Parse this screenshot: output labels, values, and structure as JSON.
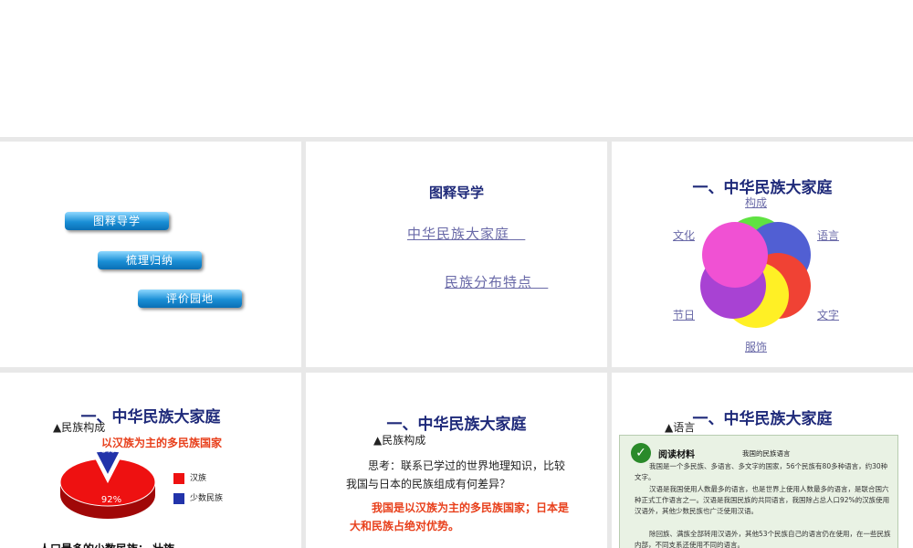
{
  "slide1": {
    "buttons": [
      "图释导学",
      "梳理归纳",
      "评价园地"
    ]
  },
  "slide2": {
    "title": "图释导学",
    "links": [
      "中华民族大家庭",
      "民族分布特点"
    ]
  },
  "slide3": {
    "title": "一、中华民族大家庭",
    "labels": {
      "top": "构成",
      "left": "文化",
      "right": "语言",
      "bottom_left": "节日",
      "bottom_right": "文字",
      "bottom": "服饰"
    },
    "colors": [
      "#44dd22",
      "#3344cc",
      "#ee2211",
      "#ffee00",
      "#9922cc",
      "#ee33cc"
    ]
  },
  "slide4": {
    "title": "一、中华民族大家庭",
    "bullet": "民族构成",
    "subtitle": "以汉族为主的多民族国家",
    "chart_data": {
      "type": "pie",
      "categories": [
        "汉族",
        "少数民族"
      ],
      "values": [
        92,
        8
      ],
      "data_labels": [
        "92%",
        "8%"
      ],
      "colors": [
        "#ee1111",
        "#2233aa"
      ]
    },
    "footer": "人口最多的少数民族：  壮族"
  },
  "slide5": {
    "title": "一、中华民族大家庭",
    "bullet": "民族构成",
    "question": "思考：联系已学过的世界地理知识，比较我国与日本的民族组成有何差异？",
    "answer": "我国是以汉族为主的多民族国家；日本是大和民族占绝对优势。"
  },
  "slide6": {
    "title": "一、中华民族大家庭",
    "bullet": "语言",
    "reading_label": "阅读材料",
    "article_title": "我国的民族语言",
    "paragraphs": [
      "我国是一个多民族、多语言、多文字的国家，56个民族有80多种语言，约30种文字。",
      "汉语是我国使用人数最多的语言，也是世界上使用人数最多的语言，是联合国六种正式工作语言之一。汉语是我国民族的共同语言，我国除占总人口92%的汉族使用汉语外，其他少数民族也广泛使用汉语。",
      "除回族、满族全部转用汉语外，其他53个民族自己的语言仍在使用，在一些民族内部，不同支系还使用不同的语言。"
    ]
  }
}
